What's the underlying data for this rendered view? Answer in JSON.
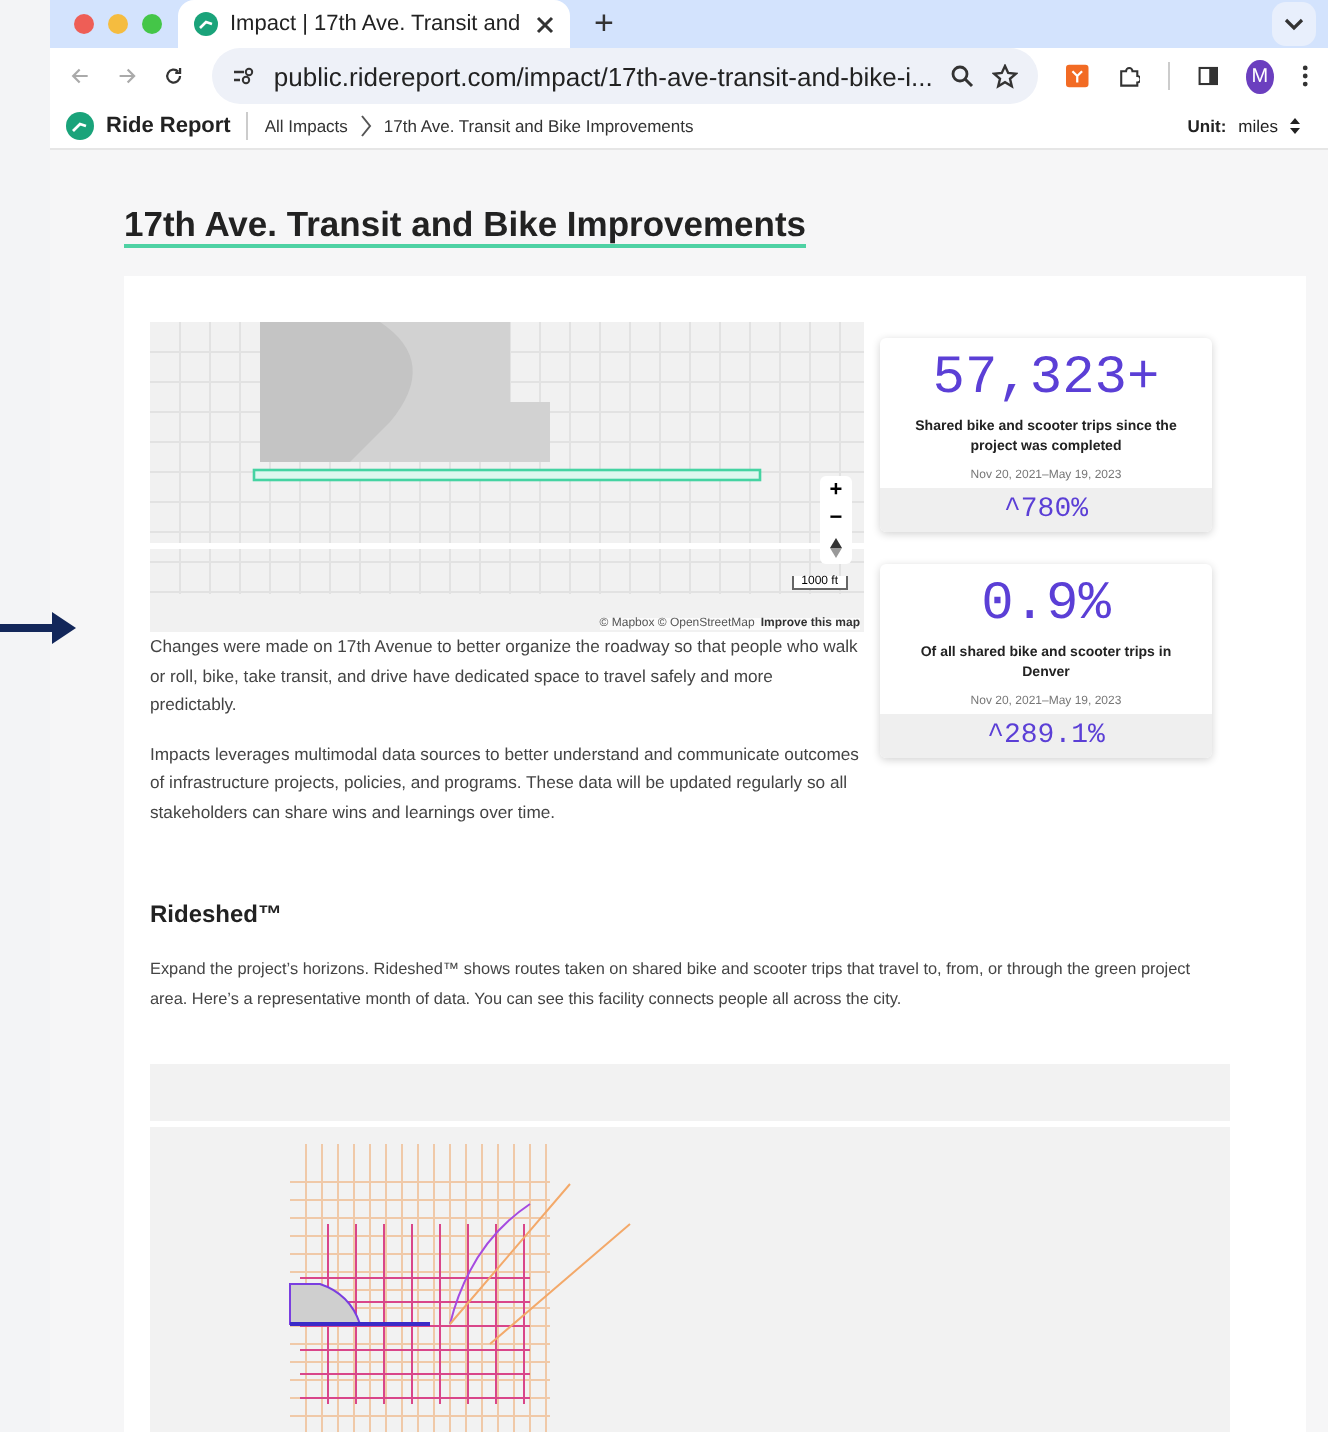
{
  "browser": {
    "tabs": [
      {
        "title": "Impact | 17th Ave. Transit and",
        "selected": true
      }
    ],
    "new_tab": "+",
    "url": "public.ridereport.com/impact/17th-ave-transit-and-bike-i...",
    "profile_initial": "M"
  },
  "site_header": {
    "logo": "Ride Report",
    "breadcrumbs": [
      "All Impacts",
      "17th Ave. Transit and Bike Improvements"
    ],
    "unit_label": "Unit:",
    "unit_value": "miles"
  },
  "page_title": "17th Ave. Transit and Bike Improvements",
  "project_map": {
    "zoom_in": "+",
    "zoom_out": "−",
    "scale": "1000 ft",
    "attribution": "© Mapbox © OpenStreetMap",
    "improve_link": "Improve this map"
  },
  "paragraphs": [
    "Changes were made on 17th Avenue to better organize the roadway so that people who walk or roll, bike, take transit, and drive have dedicated space to travel safely and more predictably.",
    "Impacts leverages multimodal data sources to better understand and communicate outcomes of infrastructure projects, policies, and programs. These data will be updated regularly so all stakeholders can share wins and learnings over time."
  ],
  "stats": [
    {
      "value": "57,323+",
      "label": "Shared bike and scooter trips since the project was completed",
      "dates": "Nov 20, 2021–May 19, 2023",
      "change": "^780%"
    },
    {
      "value": "0.9%",
      "label": "Of all shared bike and scooter trips in Denver",
      "dates": "Nov 20, 2021–May 19, 2023",
      "change": "^289.1%"
    }
  ],
  "rideshed": {
    "heading": "Rideshed™",
    "description": "Expand the project’s horizons. Rideshed™ shows routes taken on shared bike and scooter trips that travel to, from, or through the green project area. Here’s a representative month of data. You can see this facility connects people all across the city."
  }
}
